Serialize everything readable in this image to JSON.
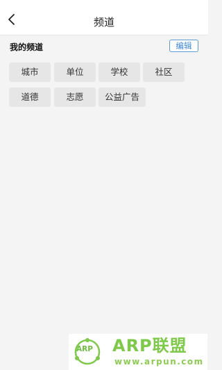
{
  "header": {
    "title": "频道",
    "back_icon": "chevron-left-icon"
  },
  "my_channels": {
    "title": "我的频道",
    "edit_label": "编辑",
    "tags": [
      "城市",
      "单位",
      "学校",
      "社区",
      "道德",
      "志愿",
      "公益广告"
    ]
  },
  "watermark": {
    "logo_text": "ARP",
    "brand": "ARP联盟",
    "url": "www.arpun.com"
  },
  "colors": {
    "accent": "#3d86d6",
    "tag_bg": "#e6e6e6",
    "page_bg": "#f4f4f4",
    "watermark_green": "#7ec94a"
  }
}
